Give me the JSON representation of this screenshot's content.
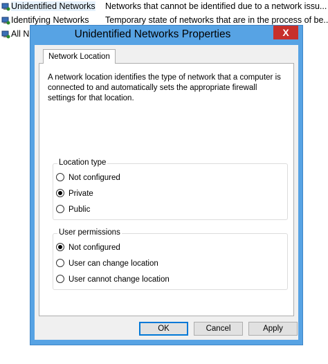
{
  "list": {
    "rows": [
      {
        "name": "Unidentified Networks",
        "desc": "Networks that cannot be identified due to a network issu..."
      },
      {
        "name": "Identifying Networks",
        "desc": "Temporary state of networks that are in the process of be..."
      },
      {
        "name": "All N",
        "desc": ""
      }
    ]
  },
  "dialog": {
    "title": "Unidentified Networks Properties",
    "close_label": "X",
    "tab_label": "Network Location",
    "intro": "A network location identifies the type of network that a computer is connected to and automatically sets the appropriate firewall settings for that location.",
    "location_group": {
      "label": "Location type",
      "options": [
        "Not configured",
        "Private",
        "Public"
      ],
      "selected": 1
    },
    "permissions_group": {
      "label": "User permissions",
      "options": [
        "Not configured",
        "User can change location",
        "User cannot change location"
      ],
      "selected": 0
    },
    "buttons": {
      "ok": "OK",
      "cancel": "Cancel",
      "apply": "Apply"
    }
  },
  "colors": {
    "accent": "#57a3e4",
    "close": "#c7302b"
  }
}
